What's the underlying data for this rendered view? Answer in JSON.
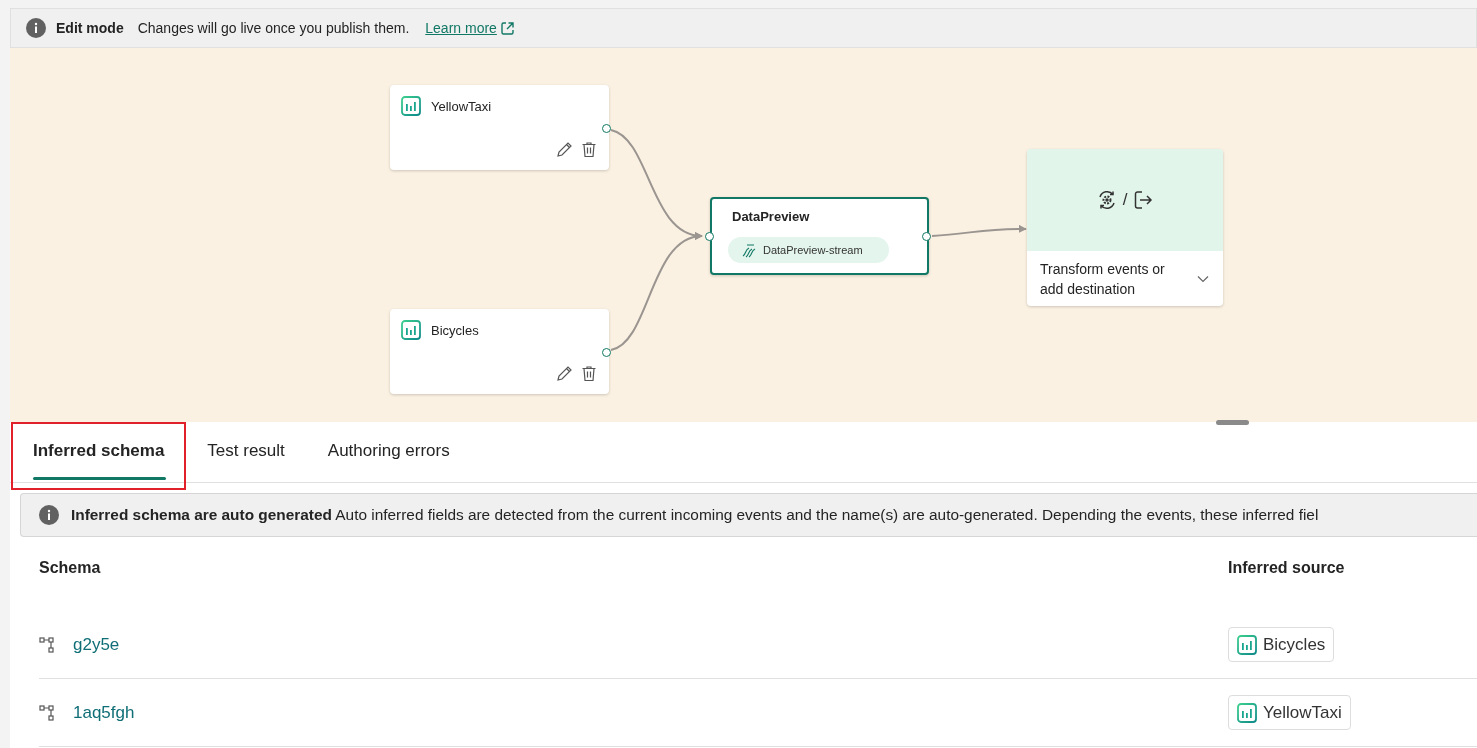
{
  "banner": {
    "title": "Edit mode",
    "message": "Changes will go live once you publish them.",
    "link": "Learn more"
  },
  "canvas": {
    "sources": [
      {
        "name": "YellowTaxi"
      },
      {
        "name": "Bicycles"
      }
    ],
    "stream": {
      "name": "DataPreview",
      "badge": "DataPreview-stream"
    },
    "destination": {
      "separator": "/",
      "label": "Transform events or add destination"
    }
  },
  "tabs": [
    {
      "label": "Inferred schema",
      "selected": true,
      "highlighted": true
    },
    {
      "label": "Test result",
      "selected": false,
      "highlighted": false
    },
    {
      "label": "Authoring errors",
      "selected": false,
      "highlighted": false
    }
  ],
  "notice": {
    "title": "Inferred schema are auto generated",
    "message": "Auto inferred fields are detected from the current incoming events and the name(s) are auto-generated. Depending the events, these inferred fiel"
  },
  "table": {
    "columns": [
      "Schema",
      "Inferred source"
    ],
    "rows": [
      {
        "schema": "g2y5e",
        "source": "Bicycles"
      },
      {
        "schema": "1aq5fgh",
        "source": "YellowTaxi"
      }
    ]
  }
}
